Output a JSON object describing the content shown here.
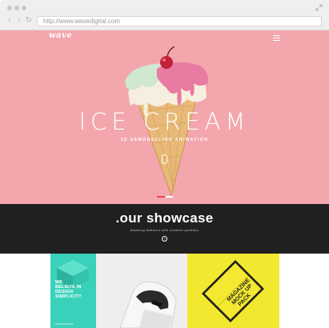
{
  "browser": {
    "url": "http://www.wavedigital.com",
    "nav": {
      "back": "‹",
      "forward": "›",
      "reload": "↻"
    }
  },
  "hero": {
    "logo": "wave",
    "title": "ICE CREAM",
    "subtitle": "3D SEMODELLING ANIMATION"
  },
  "showcase": {
    "title": ".our showcase",
    "subtitle": "Amazing features with creative portfolio"
  },
  "portfolio": {
    "teal_tile_lines": [
      "WE",
      "BELIEVE IN",
      "DESIGN SIMPLICITY"
    ],
    "teal_tile_footer": "SEMMELBINE",
    "magazine_text": [
      "MAGAZINE",
      "MOCK UP",
      "PACK"
    ]
  },
  "colors": {
    "hero_bg": "#f3a7ad",
    "showcase_bg": "#202020",
    "teal": "#3ad1ba",
    "yellow": "#f2e830",
    "slider_active": "#e8484d"
  },
  "icons": [
    "expand-icon",
    "menu-icon",
    "scroll-mouse-icon",
    "circle-icon"
  ]
}
